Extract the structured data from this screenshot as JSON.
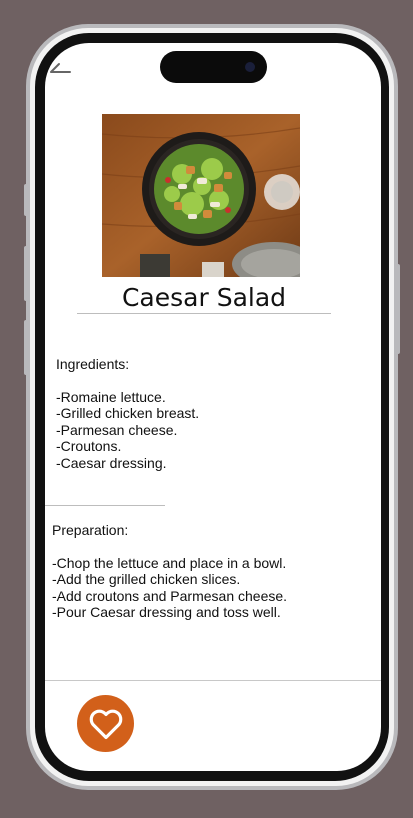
{
  "recipe": {
    "title": "Caesar Salad",
    "ingredients_heading": "Ingredients:",
    "ingredients": [
      "-Romaine lettuce.",
      "-Grilled chicken breast.",
      "-Parmesan cheese.",
      "-Croutons.",
      "-Caesar dressing."
    ],
    "preparation_heading": "Preparation:",
    "preparation": [
      "-Chop the lettuce and place in a bowl.",
      "-Add the grilled chicken slices.",
      "-Add croutons and Parmesan cheese.",
      "-Pour Caesar dressing and toss well."
    ]
  },
  "icons": {
    "back": "arrow-left-icon",
    "favorite": "heart-outline-icon"
  },
  "colors": {
    "accent": "#d2601a",
    "background": "#6f6162"
  }
}
